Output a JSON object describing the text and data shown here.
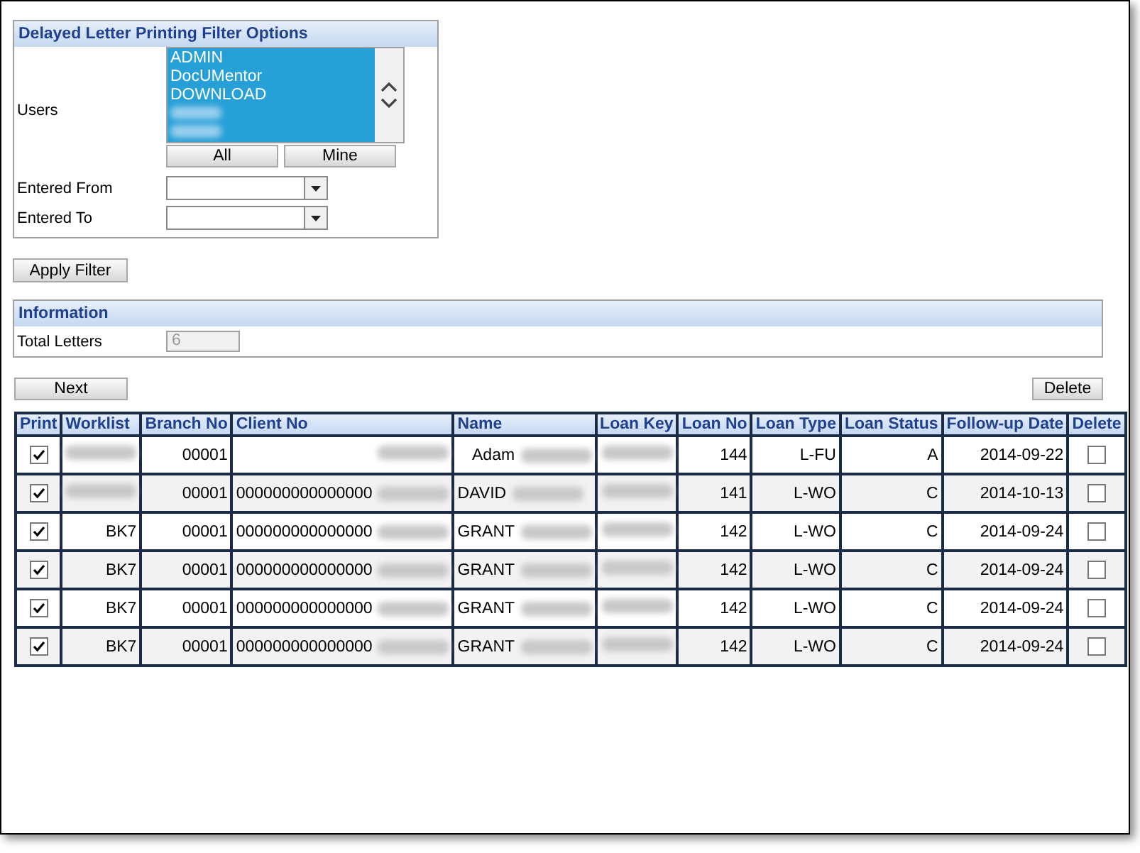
{
  "filter_panel": {
    "title": "Delayed Letter Printing Filter Options",
    "users_label": "Users",
    "users": [
      {
        "label": "ADMIN",
        "selected": true
      },
      {
        "label": "DocUMentor",
        "selected": true
      },
      {
        "label": "DOWNLOAD",
        "selected": true
      },
      {
        "blurred": true,
        "selected": true
      },
      {
        "blurred": true,
        "selected": true
      }
    ],
    "user_buttons": [
      "All",
      "Mine"
    ],
    "fields": [
      {
        "label": "Entered From"
      },
      {
        "label": "Entered To"
      }
    ]
  },
  "apply_button": "Apply Filter",
  "information": {
    "title": "Information",
    "fields": [
      {
        "label": "Total Letters",
        "value": "6",
        "disabled": true
      }
    ]
  },
  "next_button": "Next",
  "delete_button": "Delete",
  "table": {
    "columns": [
      "Print",
      "Worklist",
      "Branch No",
      "Client No",
      "Name",
      "Loan Key",
      "Loan No",
      "Loan Type",
      "Loan Status",
      "Follow-up Date",
      "Delete"
    ],
    "rows": [
      {
        "print": true,
        "worklist": {
          "blurred": true
        },
        "branch_no": "00001",
        "client_no": {
          "blurred": true
        },
        "name": {
          "text": "Adam",
          "blurred": true
        },
        "loan_key": {
          "blurred": true
        },
        "loan_no": "144",
        "loan_type": "L-FU",
        "loan_status": "A",
        "follow_up_date": "2014-09-22",
        "delete": false
      },
      {
        "print": true,
        "worklist": {
          "blurred": true
        },
        "branch_no": "00001",
        "client_no": {
          "text": "000000000000000",
          "blurred": true
        },
        "name": {
          "text": "DAVID",
          "blurred": true
        },
        "loan_key": {
          "blurred": true
        },
        "loan_no": "141",
        "loan_type": "L-WO",
        "loan_status": "C",
        "follow_up_date": "2014-10-13",
        "delete": false
      },
      {
        "print": true,
        "worklist": {
          "text": "BK7"
        },
        "branch_no": "00001",
        "client_no": {
          "text": "000000000000000",
          "blurred": true
        },
        "name": {
          "text": "GRANT",
          "blurred": true
        },
        "loan_key": {
          "blurred": true
        },
        "loan_no": "142",
        "loan_type": "L-WO",
        "loan_status": "C",
        "follow_up_date": "2014-09-24",
        "delete": false
      },
      {
        "print": true,
        "worklist": {
          "text": "BK7"
        },
        "branch_no": "00001",
        "client_no": {
          "text": "000000000000000",
          "blurred": true
        },
        "name": {
          "text": "GRANT",
          "blurred": true
        },
        "loan_key": {
          "blurred": true
        },
        "loan_no": "142",
        "loan_type": "L-WO",
        "loan_status": "C",
        "follow_up_date": "2014-09-24",
        "delete": false
      },
      {
        "print": true,
        "worklist": {
          "text": "BK7"
        },
        "branch_no": "00001",
        "client_no": {
          "text": "000000000000000",
          "blurred": true
        },
        "name": {
          "text": "GRANT",
          "blurred": true
        },
        "loan_key": {
          "blurred": true
        },
        "loan_no": "142",
        "loan_type": "L-WO",
        "loan_status": "C",
        "follow_up_date": "2014-09-24",
        "delete": false
      },
      {
        "print": true,
        "worklist": {
          "text": "BK7"
        },
        "branch_no": "00001",
        "client_no": {
          "text": "000000000000000",
          "blurred": true
        },
        "name": {
          "text": "GRANT",
          "blurred": true
        },
        "loan_key": {
          "blurred": true
        },
        "loan_no": "142",
        "loan_type": "L-WO",
        "loan_status": "C",
        "follow_up_date": "2014-09-24",
        "delete": false
      }
    ]
  }
}
